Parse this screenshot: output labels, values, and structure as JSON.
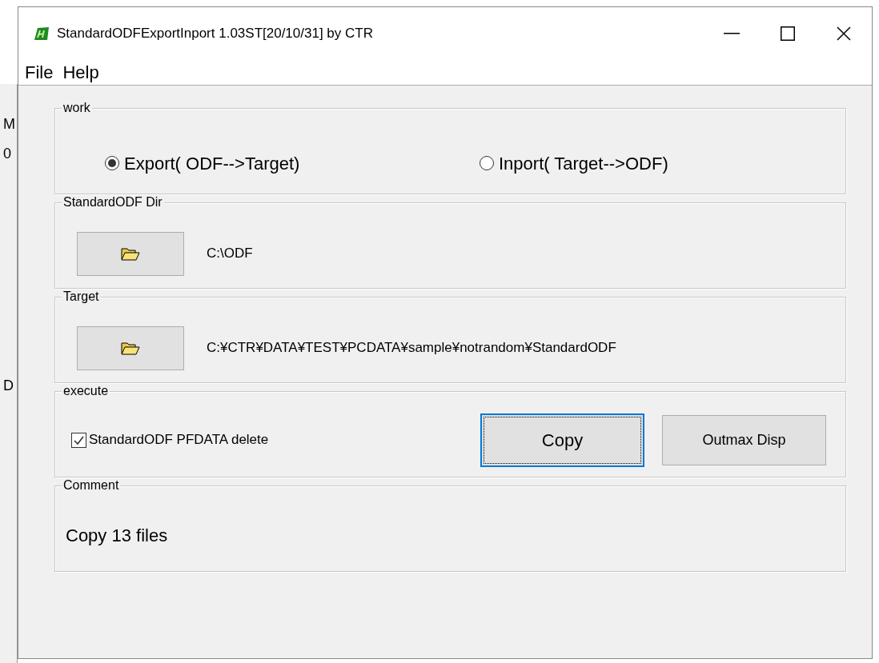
{
  "background_window": {
    "fragments": [
      "M",
      "0",
      "D"
    ]
  },
  "window": {
    "title": "StandardODFExportInport 1.03ST[20/10/31] by CTR"
  },
  "menu": [
    "File",
    "Help"
  ],
  "work": {
    "label": "work",
    "options": [
      {
        "label": "Export( ODF-->Target)",
        "selected": true
      },
      {
        "label": "Inport( Target-->ODF)",
        "selected": false
      }
    ]
  },
  "standard_odf_dir": {
    "label": "StandardODF Dir",
    "path": "C:\\ODF"
  },
  "target": {
    "label": "Target",
    "path": "C:¥CTR¥DATA¥TEST¥PCDATA¥sample¥notrandom¥StandardODF"
  },
  "execute": {
    "label": "execute",
    "checkbox": {
      "label": "StandardODF PFDATA delete",
      "checked": true
    },
    "buttons": [
      {
        "label": "Copy",
        "focused": true
      },
      {
        "label": "Outmax Disp",
        "focused": false
      }
    ]
  },
  "comment": {
    "label": "Comment",
    "text": "Copy 13 files"
  }
}
